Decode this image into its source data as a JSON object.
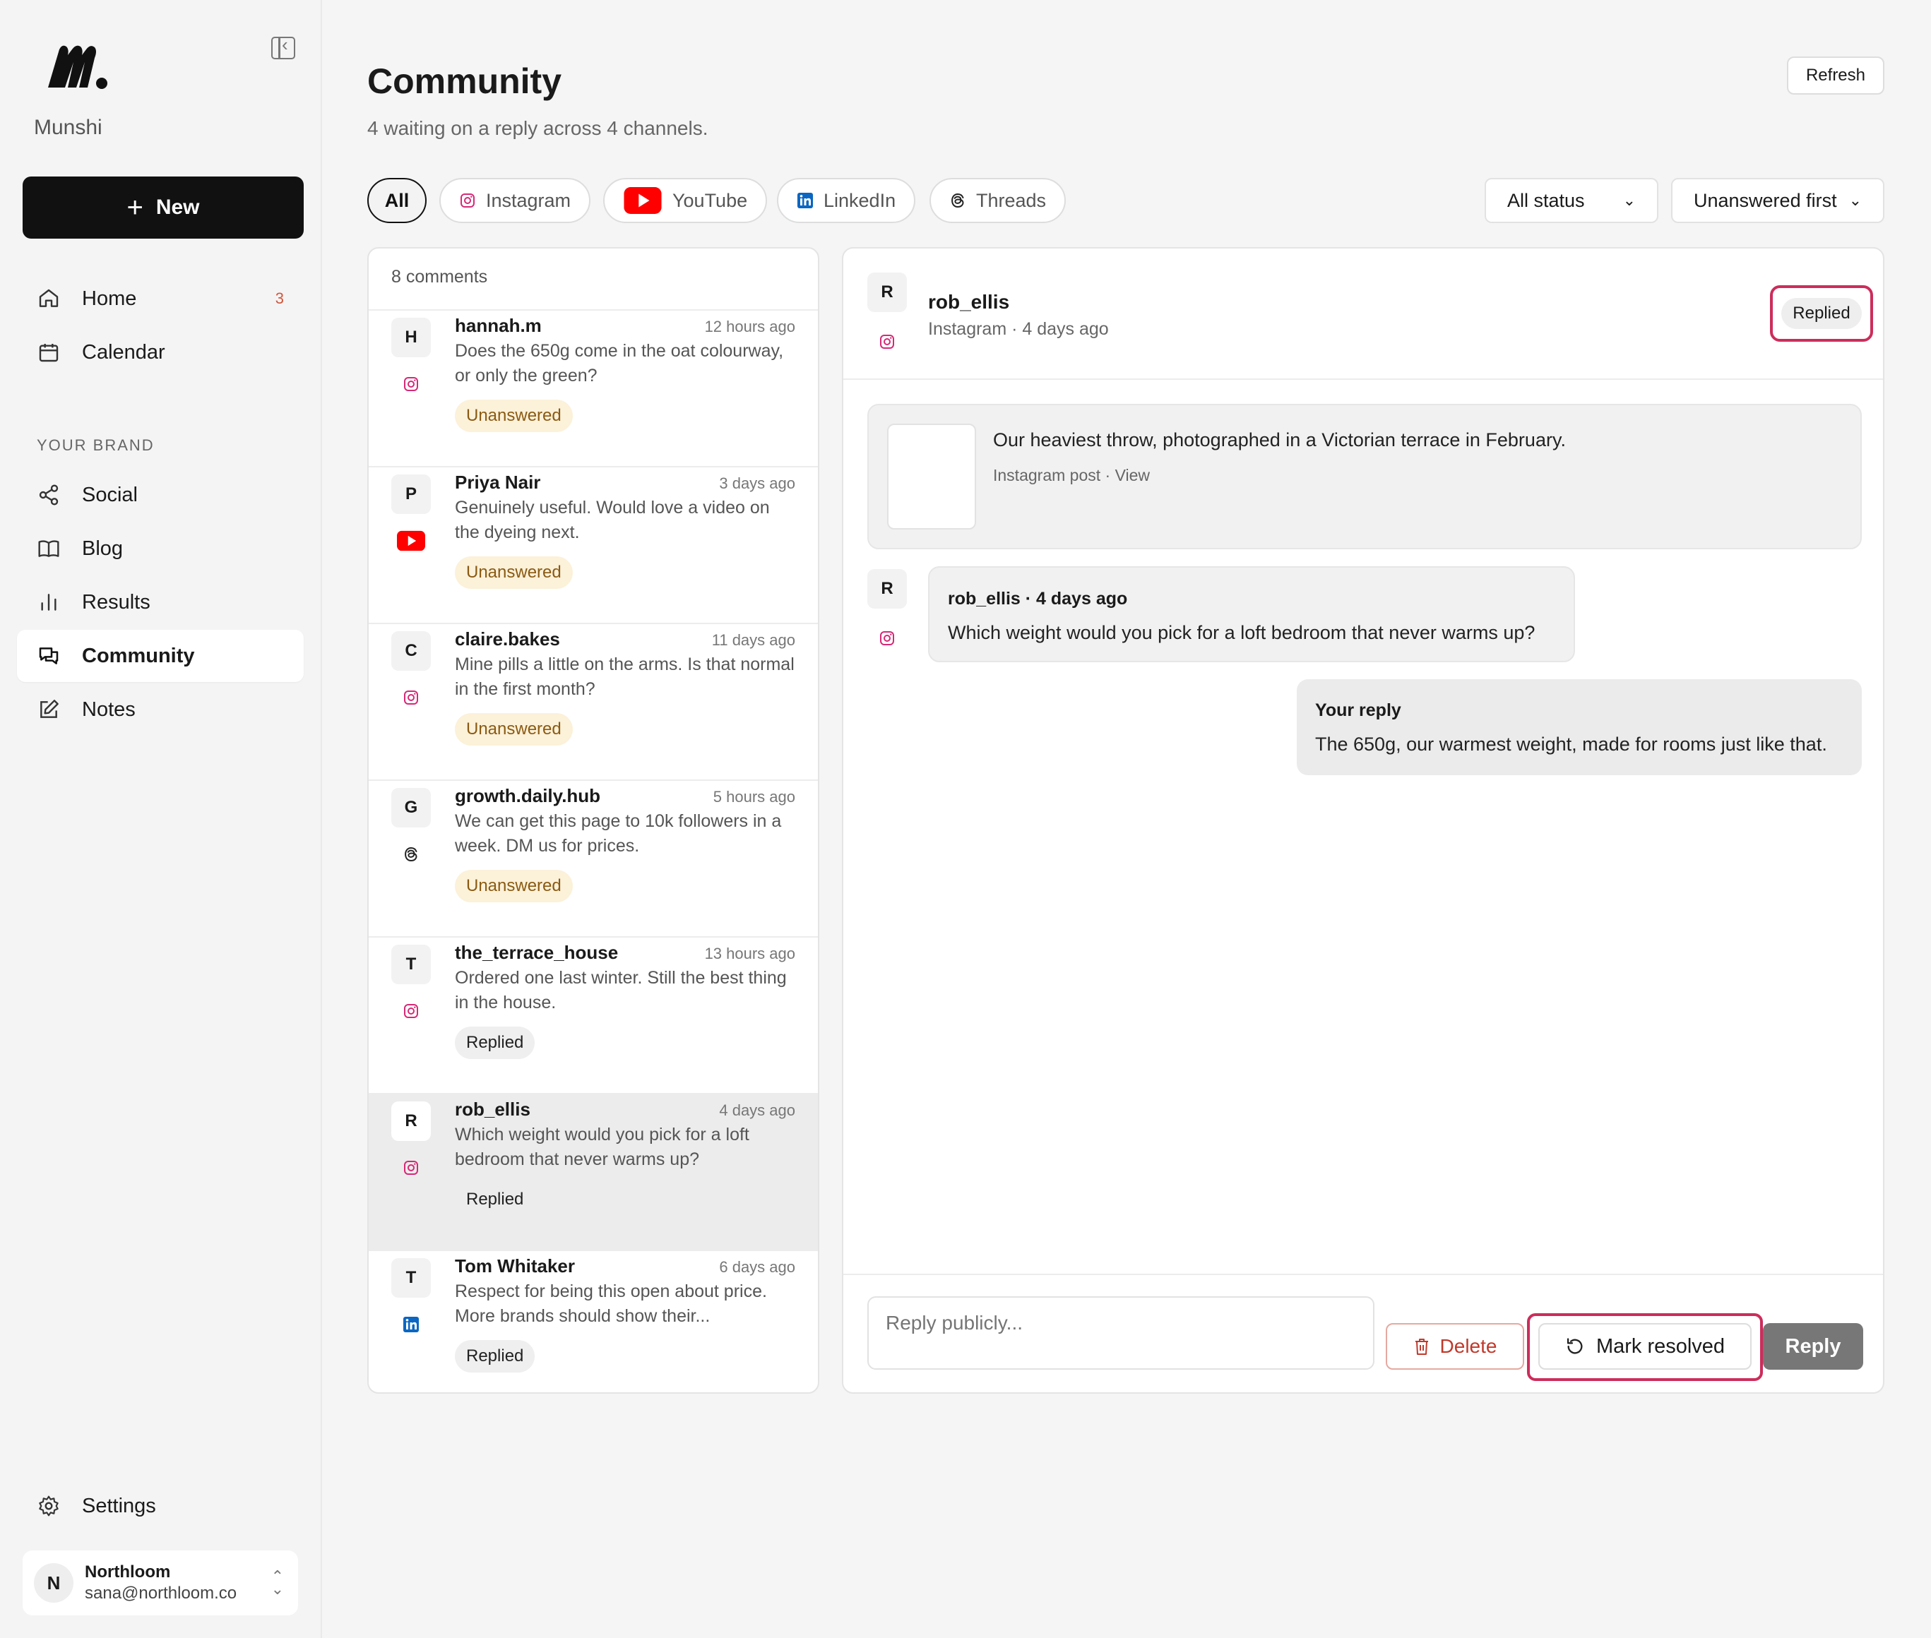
{
  "brand": {
    "name": "Munshi"
  },
  "sidebar": {
    "new_label": "New",
    "items": [
      {
        "label": "Home",
        "badge": "3"
      },
      {
        "label": "Calendar"
      }
    ],
    "section_label": "YOUR BRAND",
    "brand_items": [
      {
        "label": "Social"
      },
      {
        "label": "Blog"
      },
      {
        "label": "Results"
      },
      {
        "label": "Community"
      },
      {
        "label": "Notes"
      }
    ],
    "settings_label": "Settings",
    "account": {
      "initial": "N",
      "name": "Northloom",
      "email": "sana@northloom.co"
    }
  },
  "header": {
    "title": "Community",
    "subtitle": "4 waiting on a reply across 4 channels.",
    "refresh_label": "Refresh"
  },
  "filters": {
    "channels": [
      "All",
      "Instagram",
      "YouTube",
      "LinkedIn",
      "Threads"
    ],
    "status": "All status",
    "sort": "Unanswered first"
  },
  "list": {
    "count_label": "8 comments",
    "items": [
      {
        "initial": "H",
        "name": "hannah.m",
        "time": "12 hours ago",
        "text": "Does the 650g come in the oat colourway, or only the green?",
        "status": "Unanswered",
        "channel": "instagram"
      },
      {
        "initial": "P",
        "name": "Priya Nair",
        "time": "3 days ago",
        "text": "Genuinely useful. Would love a video on the dyeing next.",
        "status": "Unanswered",
        "channel": "youtube"
      },
      {
        "initial": "C",
        "name": "claire.bakes",
        "time": "11 days ago",
        "text": "Mine pills a little on the arms. Is that normal in the first month?",
        "status": "Unanswered",
        "channel": "instagram"
      },
      {
        "initial": "G",
        "name": "growth.daily.hub",
        "time": "5 hours ago",
        "text": "We can get this page to 10k followers in a week. DM us for prices.",
        "status": "Unanswered",
        "channel": "threads"
      },
      {
        "initial": "T",
        "name": "the_terrace_house",
        "time": "13 hours ago",
        "text": "Ordered one last winter. Still the best thing in the house.",
        "status": "Replied",
        "channel": "instagram"
      },
      {
        "initial": "R",
        "name": "rob_ellis",
        "time": "4 days ago",
        "text": "Which weight would you pick for a loft bedroom that never warms up?",
        "status": "Replied",
        "channel": "instagram"
      },
      {
        "initial": "T",
        "name": "Tom Whitaker",
        "time": "6 days ago",
        "text": "Respect for being this open about price. More brands should show their...",
        "status": "Replied",
        "channel": "linkedin"
      }
    ]
  },
  "detail": {
    "initial": "R",
    "name": "rob_ellis",
    "meta": "Instagram · 4 days ago",
    "status": "Replied",
    "post": {
      "text": "Our heaviest throw, photographed in a Victorian terrace in February.",
      "meta": "Instagram post · View"
    },
    "comment": {
      "initial": "R",
      "meta": "rob_ellis · 4 days ago",
      "text": "Which weight would you pick for a loft bedroom that never warms up?"
    },
    "reply": {
      "meta": "Your reply",
      "text": "The 650g, our warmest weight, made for rooms just like that."
    },
    "reply_placeholder": "Reply publicly...",
    "delete_label": "Delete",
    "resolve_label": "Mark resolved",
    "reply_label": "Reply"
  },
  "colors": {
    "accent_highlight": "#cc2d5b",
    "instagram": "#d62976",
    "youtube": "#ff0000",
    "linkedin": "#0a66c2",
    "unanswered_bg": "#fcf1d9"
  }
}
